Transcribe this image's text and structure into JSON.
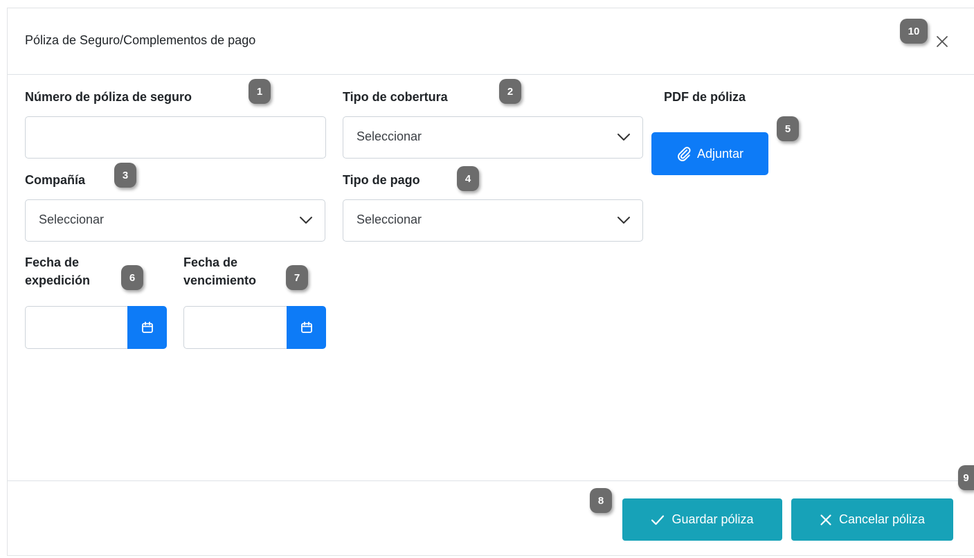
{
  "modal": {
    "title": "Póliza de Seguro/Complementos de pago",
    "close_icon": "close-icon"
  },
  "fields": {
    "policy_number": {
      "label": "Número de póliza de seguro",
      "value": ""
    },
    "coverage_type": {
      "label": "Tipo de cobertura",
      "value": "Seleccionar"
    },
    "policy_pdf": {
      "label": "PDF de póliza",
      "button_label": "Adjuntar",
      "icon": "paperclip-icon"
    },
    "company": {
      "label": "Compañía",
      "value": "Seleccionar"
    },
    "payment_type": {
      "label": "Tipo de pago",
      "value": "Seleccionar"
    },
    "issue_date": {
      "label_line1": "Fecha de",
      "label_line2": "expedición",
      "value": "",
      "icon": "calendar-icon"
    },
    "expiry_date": {
      "label_line1": "Fecha de",
      "label_line2": "vencimiento",
      "value": "",
      "icon": "calendar-icon"
    }
  },
  "footer": {
    "save_label": "Guardar póliza",
    "save_icon": "check-icon",
    "cancel_label": "Cancelar póliza",
    "cancel_icon": "x-icon"
  },
  "badges": [
    "1",
    "2",
    "3",
    "4",
    "5",
    "6",
    "7",
    "8",
    "9",
    "10"
  ],
  "colors": {
    "primary": "#0d7bf7",
    "teal": "#17a2b8",
    "badge": "#6c6c6c"
  }
}
